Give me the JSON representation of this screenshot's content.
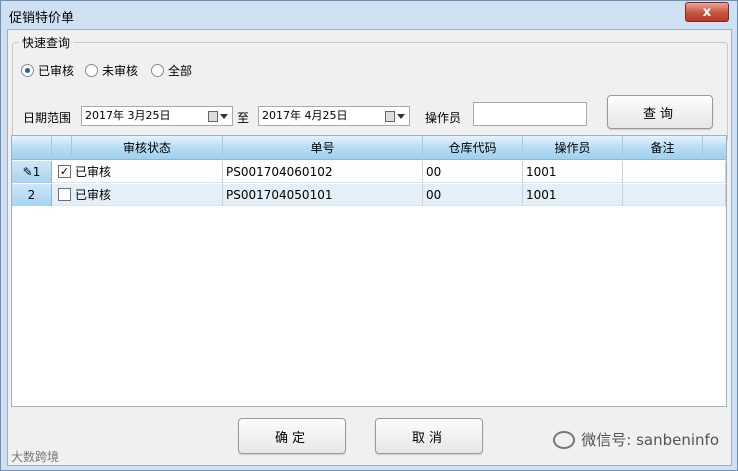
{
  "window": {
    "title": "促销特价单",
    "close_label": "x"
  },
  "quick_query": {
    "legend": "快速查询",
    "radios": [
      {
        "label": "已审核",
        "selected": true
      },
      {
        "label": "未审核",
        "selected": false
      },
      {
        "label": "全部",
        "selected": false
      }
    ],
    "date_range_label": "日期范围",
    "date_from": "2017年  3月25日",
    "to_label": "至",
    "date_to": "2017年  4月25日",
    "operator_label": "操作员",
    "operator_value": "",
    "query_button": "查询"
  },
  "grid": {
    "columns": [
      "",
      "审核状态",
      "单号",
      "仓库代码",
      "操作员",
      "备注"
    ],
    "rows": [
      {
        "num": "1",
        "checked": true,
        "status": "已审核",
        "order_no": "PS001704060102",
        "warehouse": "00",
        "operator": "1001",
        "note": ""
      },
      {
        "num": "2",
        "checked": false,
        "status": "已审核",
        "order_no": "PS001704050101",
        "warehouse": "00",
        "operator": "1001",
        "note": ""
      }
    ]
  },
  "footer": {
    "ok_button": "确定",
    "cancel_button": "取消",
    "watermark": "微信号: sanbeninfo",
    "corner_logo": "大数跨境"
  },
  "colors": {
    "title_bg": "#cfe0f2",
    "header_blue": "#9fd1ee",
    "close_red": "#c7533f"
  }
}
